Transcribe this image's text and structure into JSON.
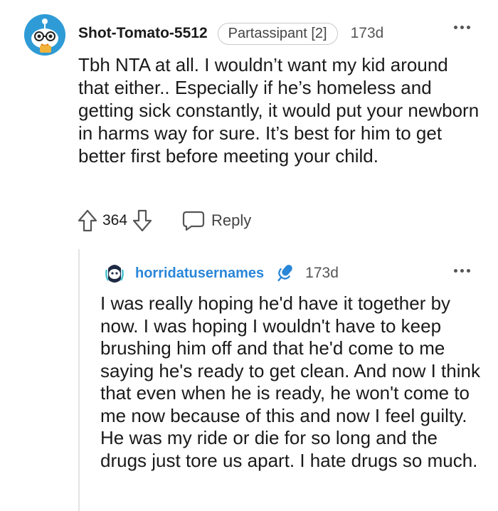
{
  "comment": {
    "username": "Shot-Tomato-5512",
    "flair": "Partassipant [2]",
    "time": "173d",
    "body": "Tbh NTA at all. I wouldn’t want my kid around that either.. Especially if he’s homeless and getting sick constantly, it would put your newborn in harms way for sure. It’s best for him to get better first before meeting your child.",
    "score": "364",
    "reply_label": "Reply"
  },
  "reply": {
    "username": "horridatusernames",
    "time": "173d",
    "body": "I was really hoping he'd have it together by now. I was hoping I wouldn't have to keep brushing him off and that he'd come to me saying he's ready to get clean. And now I think that even when he is ready, he won't come to me now because of this and now I feel guilty. He was my ride or die for so long and the drugs just tore us apart. I hate drugs so much."
  },
  "icons": {
    "upvote": "upvote-arrow-icon",
    "downvote": "downvote-arrow-icon",
    "reply": "speech-bubble-icon",
    "more": "more-dots-icon",
    "op_badge": "microphone-icon"
  },
  "colors": {
    "reply_username": "#2a86d8",
    "op_badge": "#2a86d8",
    "avatar_bg": "#2e9bd6"
  }
}
